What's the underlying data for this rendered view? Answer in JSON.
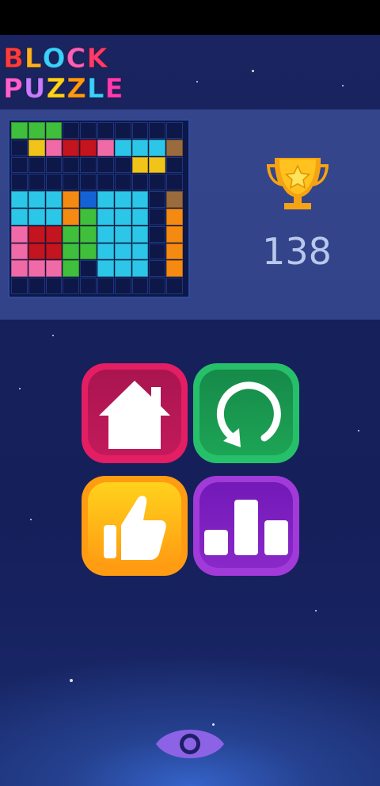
{
  "logo": {
    "line1": "BLOCK",
    "line2": "PUZZLE"
  },
  "score": "138",
  "board": {
    "cols": 10,
    "rows": 10,
    "cells": [
      [
        "G",
        "G",
        "G",
        "",
        "",
        "",
        "",
        "",
        "",
        ""
      ],
      [
        "",
        "Y",
        "P",
        "R",
        "R",
        "P",
        "C",
        "C",
        "C",
        "B"
      ],
      [
        "",
        "",
        "",
        "",
        "",
        "",
        "",
        "Y",
        "Y",
        ""
      ],
      [
        "",
        "",
        "",
        "",
        "",
        "",
        "",
        "",
        "",
        ""
      ],
      [
        "C",
        "C",
        "C",
        "O",
        "U",
        "C",
        "C",
        "C",
        "",
        "B"
      ],
      [
        "C",
        "C",
        "C",
        "O",
        "G",
        "C",
        "C",
        "C",
        "",
        "O"
      ],
      [
        "P",
        "R",
        "R",
        "G",
        "G",
        "C",
        "C",
        "C",
        "",
        "O"
      ],
      [
        "P",
        "R",
        "R",
        "G",
        "G",
        "C",
        "C",
        "C",
        "",
        "O"
      ],
      [
        "P",
        "P",
        "P",
        "G",
        "",
        "C",
        "C",
        "C",
        "",
        "O"
      ],
      [
        "",
        "",
        "",
        "",
        "",
        "",
        "",
        "",
        "",
        ""
      ]
    ],
    "colors": {
      "G": "#3fbf3b",
      "Y": "#f0c419",
      "P": "#f06aa7",
      "R": "#c4141f",
      "C": "#2cc6e8",
      "B": "#9a6b3c",
      "O": "#f58a12",
      "U": "#1463d6"
    }
  },
  "buttons": {
    "home": {
      "icon": "house-icon"
    },
    "restart": {
      "icon": "restart-arrow-icon"
    },
    "rate": {
      "icon": "thumbs-up-icon"
    },
    "leaderboard": {
      "icon": "podium-icon"
    }
  },
  "bottom": {
    "icon": "eye-icon",
    "color": "#8d63e6"
  }
}
